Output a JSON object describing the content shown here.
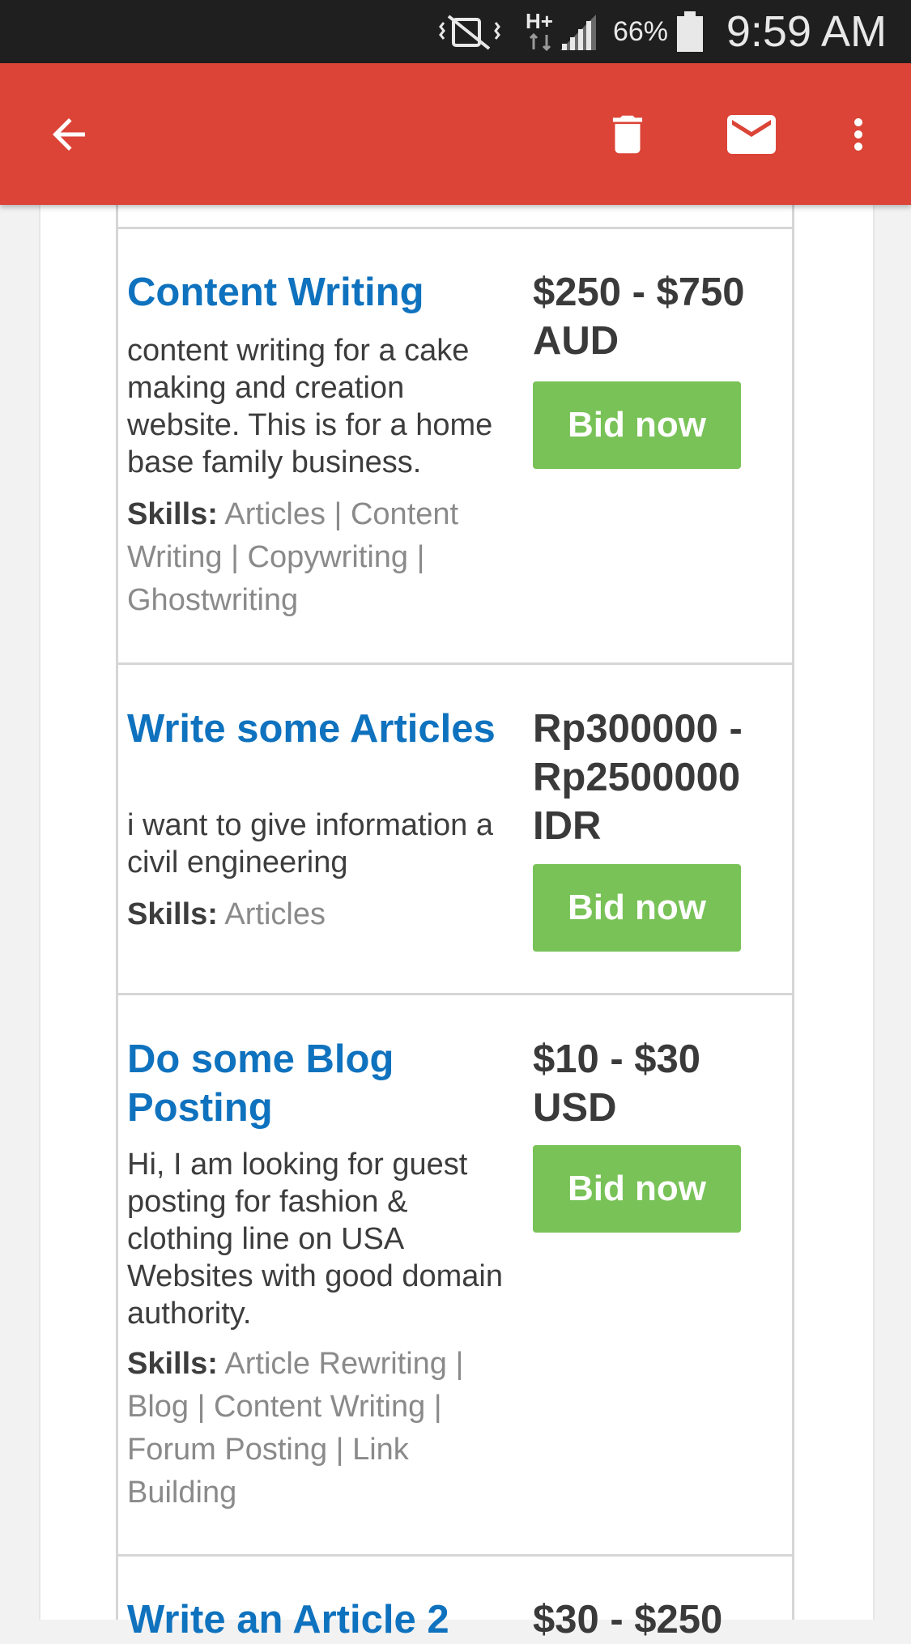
{
  "status_bar": {
    "battery": "66%",
    "time": "9:59 AM",
    "icons": [
      "vibrate-mute-icon",
      "hplus-data-icon",
      "signal-icon",
      "battery-icon"
    ]
  },
  "toolbar": {
    "icons": [
      "back-arrow-icon",
      "trash-icon",
      "mail-icon",
      "more-vert-icon"
    ],
    "color": "#db4437"
  },
  "projects": [
    {
      "title": "Content Writing",
      "price": "$250 - $750 AUD",
      "description": "content writing for a cake making and creation website. This is for a home base family business.",
      "skills_label": "Skills:",
      "skills": "Articles | Content Writing | Copywriting | Ghostwriting",
      "bid_label": "Bid now"
    },
    {
      "title": "Write some Articles",
      "price": "Rp300000 - Rp2500000 IDR",
      "description": "i want to give information a civil engineering",
      "skills_label": "Skills:",
      "skills": "Articles",
      "bid_label": "Bid now"
    },
    {
      "title": "Do some Blog Posting",
      "price": "$10 - $30 USD",
      "description": "Hi, I am looking for guest posting for fashion & clothing line on USA Websites with good domain authority.",
      "skills_label": "Skills:",
      "skills": "Article Rewriting | Blog | Content Writing | Forum Posting | Link Building",
      "bid_label": "Bid now"
    },
    {
      "title": "Write an Article 2",
      "price": "$30 - $250"
    }
  ],
  "colors": {
    "title": "#0f72be",
    "bid_button": "#78c257",
    "price": "#3a3a3a"
  }
}
